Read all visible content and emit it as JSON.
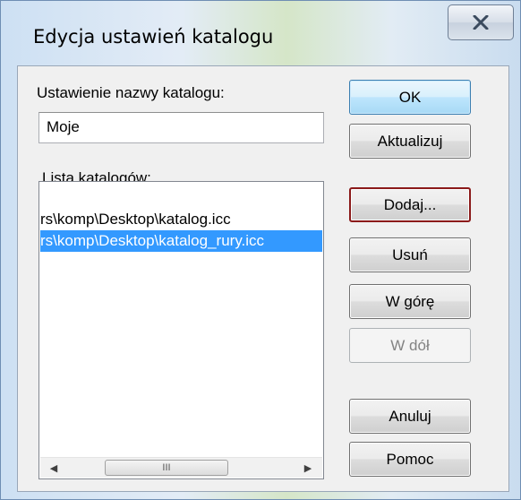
{
  "window": {
    "title": "Edycja ustawień katalogu",
    "close_glyph": "X"
  },
  "form": {
    "name_label": "Ustawienie nazwy katalogu:",
    "name_value": "Moje",
    "list_label": "Lista katalogów:"
  },
  "list": {
    "items": [
      {
        "text": "rs\\komp\\Desktop\\katalog.icc",
        "selected": false
      },
      {
        "text": "rs\\komp\\Desktop\\katalog_rury.icc",
        "selected": true
      }
    ],
    "scroll_left": "◀",
    "scroll_right": "▶",
    "scroll_thumb_grip": "III"
  },
  "buttons": {
    "ok": "OK",
    "update": "Aktualizuj",
    "add": "Dodaj...",
    "remove": "Usuń",
    "up": "W górę",
    "down": "W dół",
    "cancel": "Anuluj",
    "help": "Pomoc"
  },
  "colors": {
    "selection": "#3399ff",
    "focus_border": "#8b1a1a"
  }
}
